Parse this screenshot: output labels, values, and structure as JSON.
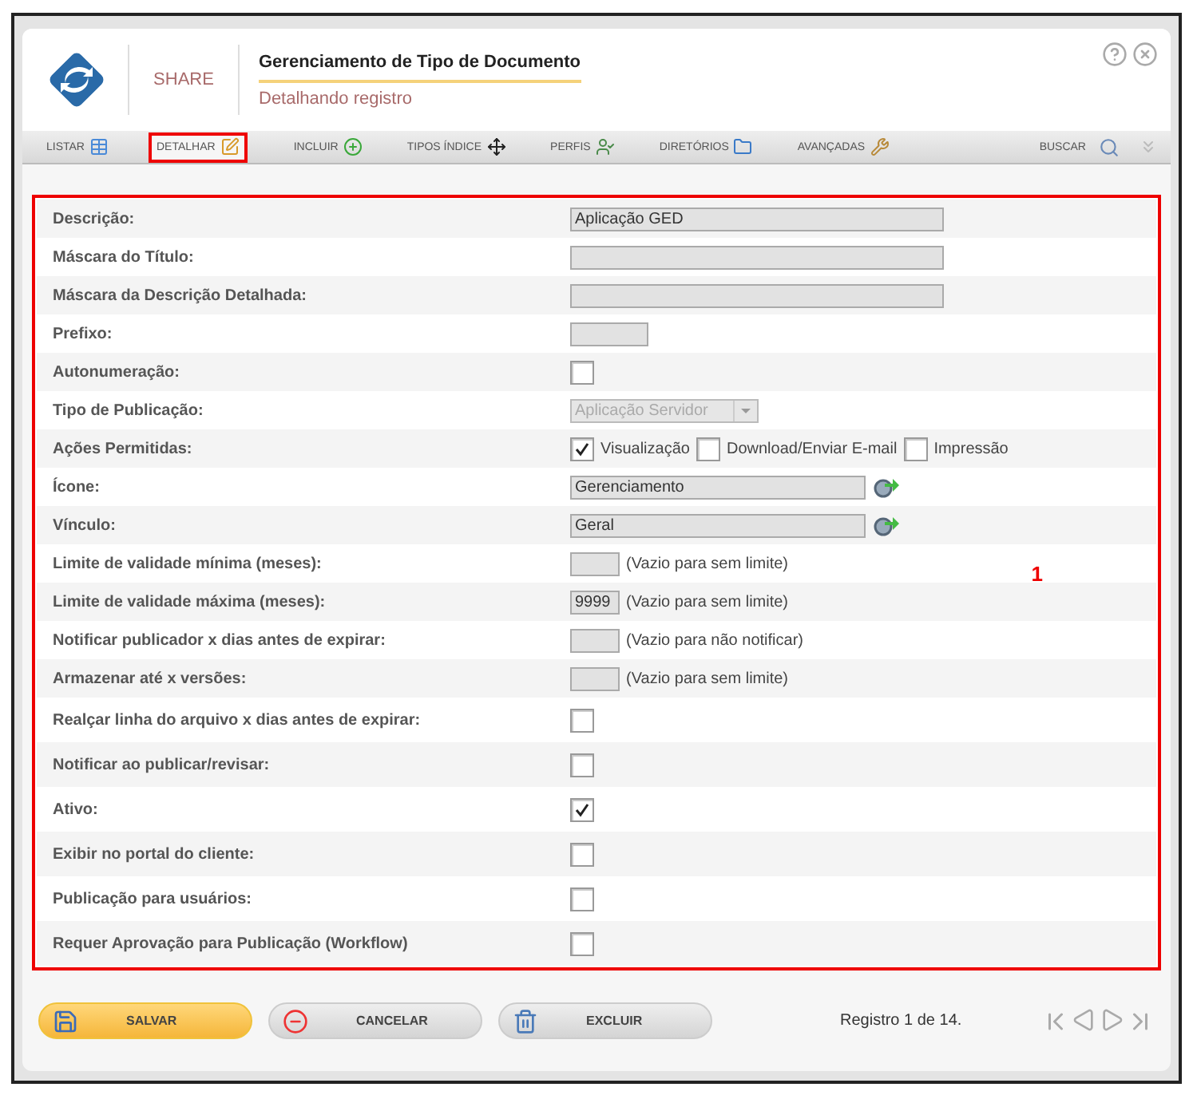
{
  "header": {
    "brand": "SHARE",
    "title": "Gerenciamento de Tipo de Documento",
    "subtitle": "Detalhando registro"
  },
  "tabs": [
    {
      "label": "LISTAR",
      "selected": false,
      "highlighted": false
    },
    {
      "label": "DETALHAR",
      "selected": true,
      "highlighted": true
    },
    {
      "label": "INCLUIR",
      "selected": false,
      "highlighted": false
    },
    {
      "label": "TIPOS ÍNDICE",
      "selected": false,
      "highlighted": false
    },
    {
      "label": "PERFIS",
      "selected": false,
      "highlighted": false
    },
    {
      "label": "DIRETÓRIOS",
      "selected": false,
      "highlighted": false
    },
    {
      "label": "AVANÇADAS",
      "selected": false,
      "highlighted": false
    }
  ],
  "search": {
    "label": "BUSCAR"
  },
  "form": {
    "annotation": "1",
    "rows": [
      {
        "kind": "text",
        "label": "Descrição:",
        "value": "Aplicação GED"
      },
      {
        "kind": "text",
        "label": "Máscara do Título:"
      },
      {
        "kind": "text",
        "label": "Máscara da Descrição Detalhada:"
      },
      {
        "kind": "short",
        "label": "Prefixo:"
      },
      {
        "kind": "checkbox",
        "label": "Autonumeração:",
        "checked": false
      },
      {
        "kind": "select",
        "label": "Tipo de Publicação:",
        "value": "Aplicação Servidor",
        "disabled": true
      },
      {
        "kind": "checkgroup",
        "label": "Ações Permitidas:",
        "options": [
          {
            "label": "Visualização",
            "checked": true
          },
          {
            "label": "Download/Enviar E-mail",
            "checked": false
          },
          {
            "label": "Impressão",
            "checked": false
          }
        ]
      },
      {
        "kind": "lookup",
        "label": "Ícone:",
        "value": "Gerenciamento"
      },
      {
        "kind": "lookup",
        "label": "Vínculo:",
        "value": "Geral"
      },
      {
        "kind": "number",
        "label": "Limite de validade mínima (meses):",
        "hint": "(Vazio para sem limite)"
      },
      {
        "kind": "number",
        "label": "Limite de validade máxima (meses):",
        "value": "9999",
        "hint": "(Vazio para sem limite)"
      },
      {
        "kind": "number",
        "label": "Notificar publicador x dias antes de expirar:",
        "hint": "(Vazio para não notificar)"
      },
      {
        "kind": "number",
        "label": "Armazenar até x versões:",
        "hint": "(Vazio para sem limite)"
      },
      {
        "kind": "checkbox",
        "label": "Realçar linha do arquivo x dias antes de expirar:",
        "checked": false
      },
      {
        "kind": "checkbox",
        "label": "Notificar ao publicar/revisar:",
        "checked": false
      },
      {
        "kind": "checkbox",
        "label": "Ativo:",
        "checked": true
      },
      {
        "kind": "checkbox",
        "label": "Exibir no portal do cliente:",
        "checked": false
      },
      {
        "kind": "checkbox",
        "label": "Publicação para usuários:",
        "checked": false
      },
      {
        "kind": "checkbox",
        "label": "Requer Aprovação para Publicação (Workflow)",
        "checked": false
      }
    ]
  },
  "footer": {
    "buttons": [
      {
        "label": "SALVAR",
        "kind": "save",
        "primary": true
      },
      {
        "label": "CANCELAR",
        "kind": "cancel",
        "primary": false
      },
      {
        "label": "EXCLUIR",
        "kind": "delete",
        "primary": false
      }
    ],
    "record": "Registro 1 de 14."
  }
}
